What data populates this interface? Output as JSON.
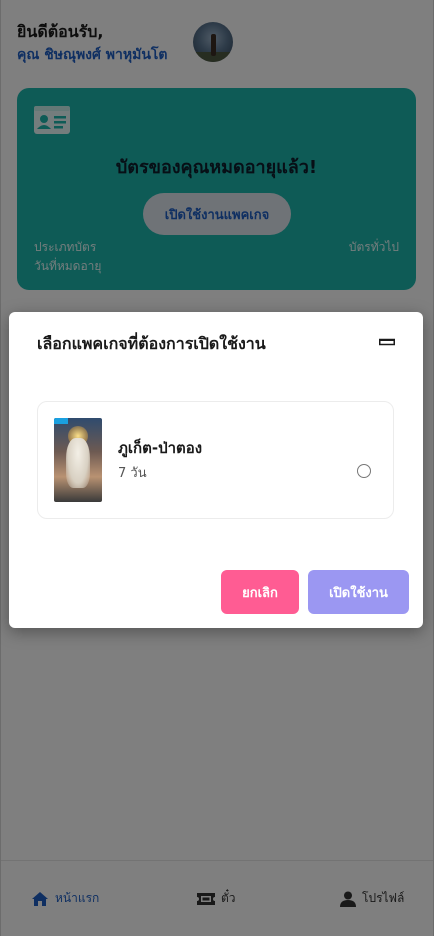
{
  "header": {
    "greeting": "ยินดีต้อนรับ,",
    "user_name": "คุณ ชิษณุพงศ์ พาหุมันโต"
  },
  "card": {
    "title": "บัตรของคุณหมดอายุแล้ว!",
    "activate_label": "เปิดใช้งานแพคเกจ",
    "card_type_label": "ประเภทบัตร",
    "expiry_label": "วันที่หมดอายุ",
    "card_type_value": "บัตรทั่วไป",
    "color": "#1db6ad"
  },
  "modal": {
    "title": "เลือกแพคเกจที่ต้องการเปิดใช้งาน",
    "packages": [
      {
        "name": "ภูเก็ต-ป่าตอง",
        "duration": "7 วัน",
        "selected": false
      }
    ],
    "cancel_label": "ยกเลิก",
    "activate_label": "เปิดใช้งาน",
    "cancel_color": "#ff5c93",
    "activate_color": "#9b97f2"
  },
  "bottom_nav": {
    "items": [
      {
        "label": "หน้าแรก",
        "icon": "home-icon",
        "active": true
      },
      {
        "label": "ตั๋ว",
        "icon": "ticket-icon",
        "active": false
      },
      {
        "label": "โปรไฟล์",
        "icon": "user-icon",
        "active": false
      }
    ],
    "active_color": "#1e5fc4"
  }
}
